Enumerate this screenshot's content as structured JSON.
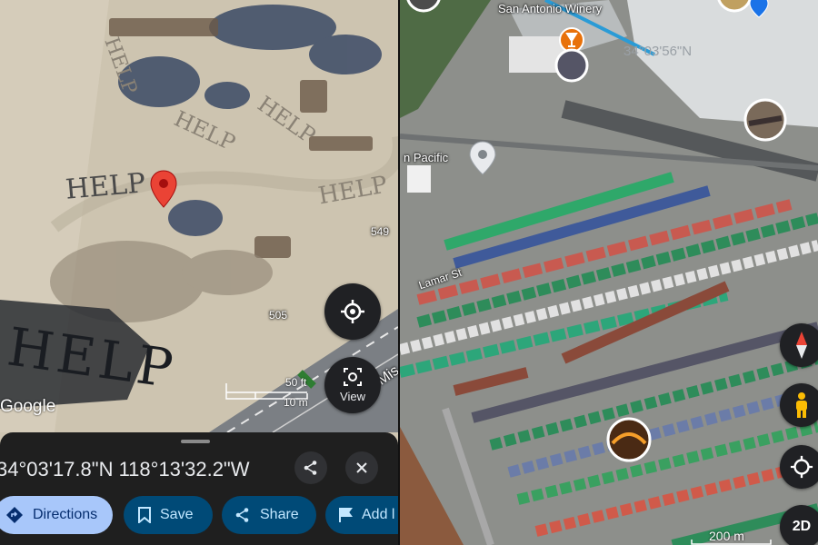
{
  "left_map": {
    "ground_text": [
      "HELP",
      "HELP",
      "HELP",
      "HELP",
      "HELP",
      "HELP"
    ],
    "road_labels": [
      "549",
      "505"
    ],
    "street_partial": "Mis",
    "scale": {
      "feet": "50 ft",
      "meters": "10 m"
    },
    "google_logo": "Google",
    "view_button_label": "View"
  },
  "place_sheet": {
    "coordinates": "34°03'17.8\"N 118°13'32.2\"W",
    "actions": [
      {
        "label": "Directions",
        "icon": "directions-icon"
      },
      {
        "label": "Save",
        "icon": "bookmark-icon"
      },
      {
        "label": "Share",
        "icon": "share-icon"
      },
      {
        "label": "Add l",
        "icon": "flag-icon"
      }
    ]
  },
  "right_map": {
    "place_labels": [
      "San Antonio Winery",
      "n Pacific",
      "Lamar St"
    ],
    "coordinate_watermark": "34°03'56\"N",
    "scale": "200 m",
    "mode_button": "2D"
  },
  "colors": {
    "pin": "#ea4335",
    "directions_chip": "#a8c7fa",
    "secondary_chip": "#004a77",
    "sheet": "#1f1f1f",
    "compass_red": "#ea4335",
    "pegman": "#fbbc04"
  }
}
